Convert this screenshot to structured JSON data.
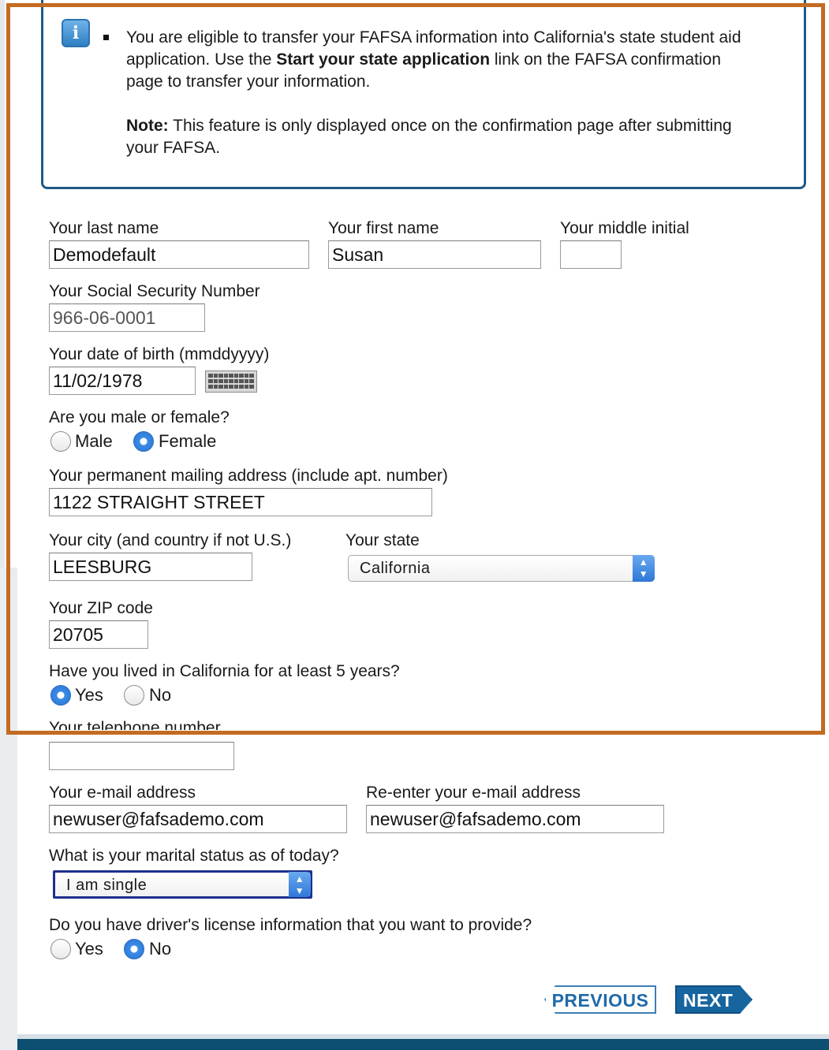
{
  "info": {
    "icon": "info-icon",
    "line1_pre": "You are eligible to transfer your FAFSA information into California's state student aid application. Use the ",
    "line1_bold": "Start your state application",
    "line1_post": " link on the FAFSA confirmation page to transfer your information.",
    "note_label": "Note:",
    "note_text": " This feature is only displayed once on the confirmation page after submitting your FAFSA."
  },
  "form": {
    "last_name": {
      "label": "Your last name",
      "value": "Demodefault"
    },
    "first_name": {
      "label": "Your first name",
      "value": "Susan"
    },
    "middle_initial": {
      "label": "Your middle initial",
      "value": ""
    },
    "ssn": {
      "label": "Your Social Security Number",
      "value": "966-06-0001"
    },
    "dob": {
      "label": "Your date of birth (mmddyyyy)",
      "value": "11/02/1978",
      "icon": "keyboard-icon"
    },
    "gender": {
      "label": "Are you male or female?",
      "options": [
        "Male",
        "Female"
      ],
      "selected": "Female"
    },
    "address": {
      "label": "Your permanent mailing address (include apt. number)",
      "value": "1122 STRAIGHT STREET"
    },
    "city": {
      "label": "Your city (and country if not U.S.)",
      "value": "LEESBURG"
    },
    "state": {
      "label": "Your state",
      "value": "California"
    },
    "zip": {
      "label": "Your ZIP code",
      "value": "20705"
    },
    "lived_5_years": {
      "label": "Have you lived in California for at least 5 years?",
      "options": [
        "Yes",
        "No"
      ],
      "selected": "Yes"
    },
    "telephone": {
      "label": "Your telephone number",
      "value": ""
    },
    "email": {
      "label": "Your e-mail address",
      "value": "newuser@fafsademo.com"
    },
    "email_confirm": {
      "label": "Re-enter your e-mail address",
      "value": "newuser@fafsademo.com"
    },
    "marital_status": {
      "label": "What is your marital status as of today?",
      "value": "I am single"
    },
    "drivers_license": {
      "label": "Do you have driver's license information that you want to provide?",
      "options": [
        "Yes",
        "No"
      ],
      "selected": "No"
    }
  },
  "nav": {
    "previous": "PREVIOUS",
    "next": "NEXT"
  },
  "colors": {
    "highlight": "#c36b21",
    "brand": "#17659f",
    "radio_selected": "#2a74d4"
  }
}
